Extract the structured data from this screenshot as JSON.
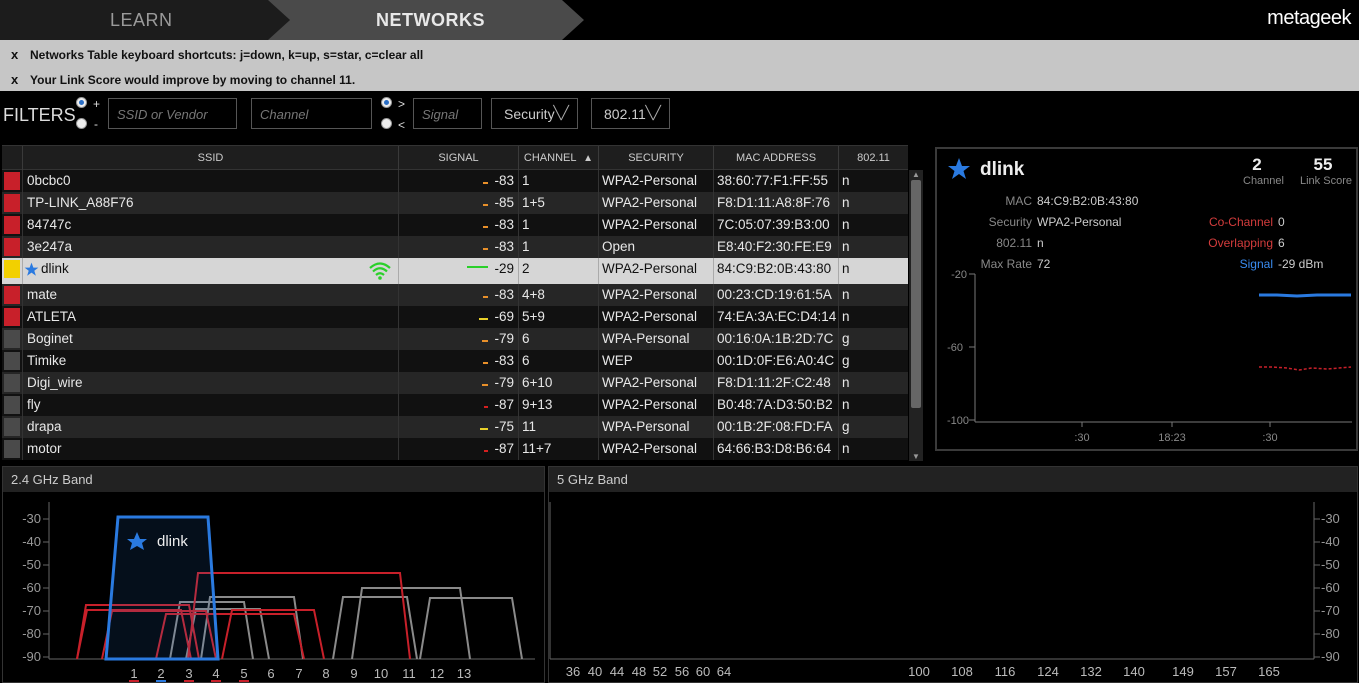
{
  "nav": {
    "learn": "LEARN",
    "networks": "NETWORKS",
    "brand": "metageek"
  },
  "notices": [
    {
      "close": "x",
      "text": "Networks Table keyboard shortcuts: j=down, k=up, s=star, c=clear all"
    },
    {
      "close": "x",
      "text": "Your Link Score would improve by moving to channel 11."
    }
  ],
  "filters": {
    "label": "FILTERS",
    "plus": "+",
    "minus": "-",
    "ssid_placeholder": "SSID or Vendor",
    "channel_placeholder": "Channel",
    "gt": ">",
    "lt": "<",
    "signal_placeholder": "Signal",
    "security": "Security",
    "dot11": "802.11"
  },
  "table": {
    "headers": [
      "SSID",
      "SIGNAL",
      "CHANNEL",
      "SECURITY",
      "MAC ADDRESS",
      "802.11"
    ],
    "sort_indicator": "▲",
    "rows": [
      {
        "color": "#c8202a",
        "ssid": "0bcbc0",
        "signal": "-83",
        "channel": "1",
        "security": "WPA2-Personal",
        "mac": "38:60:77:F1:FF:55",
        "dot11": "n",
        "sigcolor": "#e8902a"
      },
      {
        "color": "#c8202a",
        "ssid": "TP-LINK_A88F76",
        "signal": "-85",
        "channel": "1+5",
        "security": "WPA2-Personal",
        "mac": "F8:D1:11:A8:8F:76",
        "dot11": "n",
        "sigcolor": "#e8902a"
      },
      {
        "color": "#c8202a",
        "ssid": "84747c",
        "signal": "-83",
        "channel": "1",
        "security": "WPA2-Personal",
        "mac": "7C:05:07:39:B3:00",
        "dot11": "n",
        "sigcolor": "#e8902a"
      },
      {
        "color": "#c8202a",
        "ssid": "3e247a",
        "signal": "-83",
        "channel": "1",
        "security": "Open",
        "mac": "E8:40:F2:30:FE:E9",
        "dot11": "n",
        "sigcolor": "#e8902a"
      },
      {
        "color": "#f2d000",
        "ssid": "dlink",
        "signal": "-29",
        "channel": "2",
        "security": "WPA2-Personal",
        "mac": "84:C9:B2:0B:43:80",
        "dot11": "n",
        "sigcolor": "#2ad02a",
        "starred": true,
        "connected": true
      },
      {
        "color": "#c8202a",
        "ssid": "mate",
        "signal": "-83",
        "channel": "4+8",
        "security": "WPA2-Personal",
        "mac": "00:23:CD:19:61:5A",
        "dot11": "n",
        "sigcolor": "#e8902a"
      },
      {
        "color": "#c8202a",
        "ssid": "ATLETA",
        "signal": "-69",
        "channel": "5+9",
        "security": "WPA2-Personal",
        "mac": "74:EA:3A:EC:D4:14",
        "dot11": "n",
        "sigcolor": "#e8d02a"
      },
      {
        "color": "#4a4a4a",
        "ssid": "Boginet",
        "signal": "-79",
        "channel": "6",
        "security": "WPA-Personal",
        "mac": "00:16:0A:1B:2D:7C",
        "dot11": "g",
        "sigcolor": "#e8902a"
      },
      {
        "color": "#4a4a4a",
        "ssid": "Timike",
        "signal": "-83",
        "channel": "6",
        "security": "WEP",
        "mac": "00:1D:0F:E6:A0:4C",
        "dot11": "g",
        "sigcolor": "#e8902a"
      },
      {
        "color": "#4a4a4a",
        "ssid": "Digi_wire",
        "signal": "-79",
        "channel": "6+10",
        "security": "WPA2-Personal",
        "mac": "F8:D1:11:2F:C2:48",
        "dot11": "n",
        "sigcolor": "#e8902a"
      },
      {
        "color": "#4a4a4a",
        "ssid": "fly",
        "signal": "-87",
        "channel": "9+13",
        "security": "WPA2-Personal",
        "mac": "B0:48:7A:D3:50:B2",
        "dot11": "n",
        "sigcolor": "#d42020"
      },
      {
        "color": "#4a4a4a",
        "ssid": "drapa",
        "signal": "-75",
        "channel": "11",
        "security": "WPA-Personal",
        "mac": "00:1B:2F:08:FD:FA",
        "dot11": "g",
        "sigcolor": "#e8d02a"
      },
      {
        "color": "#4a4a4a",
        "ssid": "motor",
        "signal": "-87",
        "channel": "11+7",
        "security": "WPA2-Personal",
        "mac": "64:66:B3:D8:B6:64",
        "dot11": "n",
        "sigcolor": "#d42020"
      }
    ]
  },
  "detail": {
    "ssid": "dlink",
    "channel_value": "2",
    "channel_label": "Channel",
    "linkscore_value": "55",
    "linkscore_label": "Link Score",
    "mac_label": "MAC",
    "mac": "84:C9:B2:0B:43:80",
    "security_label": "Security",
    "security": "WPA2-Personal",
    "dot11_label": "802.11",
    "dot11": "n",
    "maxrate_label": "Max Rate",
    "maxrate": "72",
    "cochannel_label": "Co-Channel",
    "cochannel": "0",
    "overlapping_label": "Overlapping",
    "overlapping": "6",
    "signal_label": "Signal",
    "signal": "-29 dBm",
    "y_ticks": [
      "-20",
      "-60",
      "-100"
    ],
    "x_ticks": [
      ":30",
      "18:23",
      ":30"
    ]
  },
  "band24": {
    "title": "2.4 GHz Band",
    "y_ticks": [
      "-30",
      "-40",
      "-50",
      "-60",
      "-70",
      "-80",
      "-90"
    ],
    "channels": [
      "1",
      "2",
      "3",
      "4",
      "5",
      "6",
      "7",
      "8",
      "9",
      "10",
      "11",
      "12",
      "13"
    ],
    "highlight_label": "dlink"
  },
  "band5": {
    "title": "5 GHz Band",
    "y_ticks": [
      "-30",
      "-40",
      "-50",
      "-60",
      "-70",
      "-80",
      "-90"
    ],
    "channels": [
      "36",
      "40",
      "44",
      "48",
      "52",
      "56",
      "60",
      "64",
      "100",
      "108",
      "116",
      "124",
      "132",
      "140",
      "149",
      "157",
      "165"
    ]
  },
  "colors": {
    "accent": "#2a7ae0",
    "warn": "#c8202a",
    "selected": "#d6d6d6",
    "connected": "#2ad02a"
  }
}
